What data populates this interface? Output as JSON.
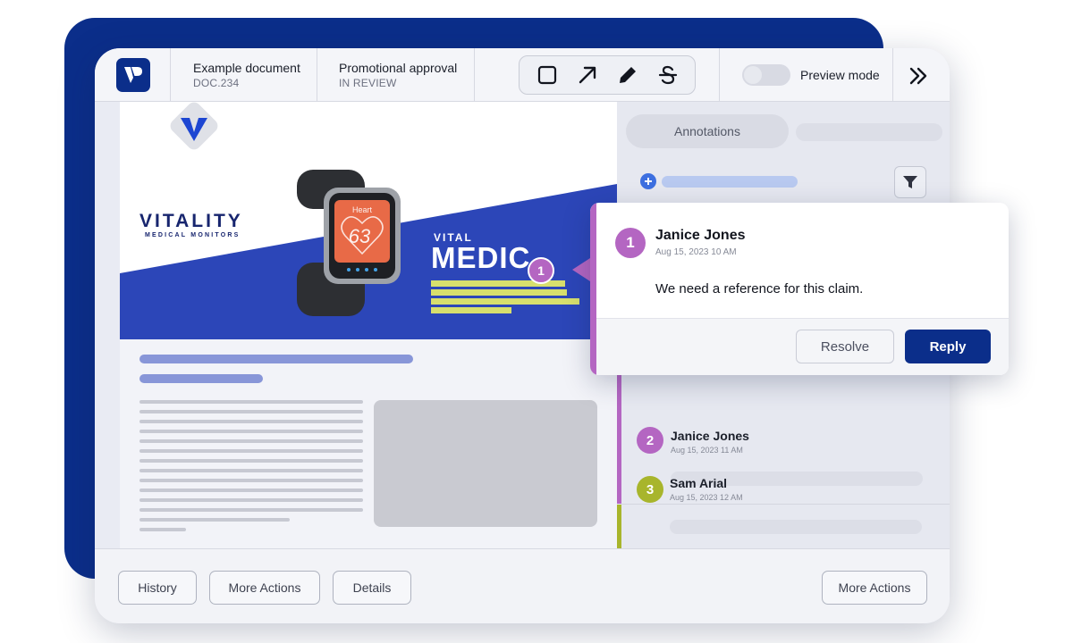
{
  "header": {
    "document_title": "Example document",
    "document_id": "DOC.234",
    "workflow_title": "Promotional approval",
    "workflow_status": "IN REVIEW",
    "preview_label": "Preview mode",
    "preview_enabled": false,
    "tools": [
      "rectangle-tool-icon",
      "arrow-tool-icon",
      "pen-tool-icon",
      "strikethrough-tool-icon"
    ]
  },
  "document": {
    "brand_name": "VITALITY",
    "brand_subtitle": "MEDICAL MONITORS",
    "banner_small": "VITAL",
    "banner_large": "MEDIC",
    "watch_word": "Heart",
    "watch_value": "63",
    "marker_number": "1",
    "colors": {
      "banner": "#2c46b8",
      "highlight": "#d7df6d",
      "brand": "#17256e"
    }
  },
  "panel": {
    "tab_label": "Annotations",
    "comments": [
      {
        "number": "1",
        "author": "Janice Jones",
        "date": "Aug 15, 2023 10 AM",
        "message": "We need a reference for this claim.",
        "color": "#b466c2"
      },
      {
        "number": "2",
        "author": "Janice Jones",
        "date": "Aug 15, 2023 11 AM",
        "color": "#b466c2"
      },
      {
        "number": "3",
        "author": "Sam Arial",
        "date": "Aug 15, 2023 12 AM",
        "color": "#a8b52c"
      }
    ]
  },
  "popup": {
    "resolve_label": "Resolve",
    "reply_label": "Reply"
  },
  "footer": {
    "history_label": "History",
    "more_actions_label": "More Actions",
    "details_label": "Details",
    "more_actions_right_label": "More Actions"
  },
  "colors": {
    "primary": "#0b2e8a",
    "accent_purple": "#b466c2",
    "accent_olive": "#a8b52c"
  }
}
